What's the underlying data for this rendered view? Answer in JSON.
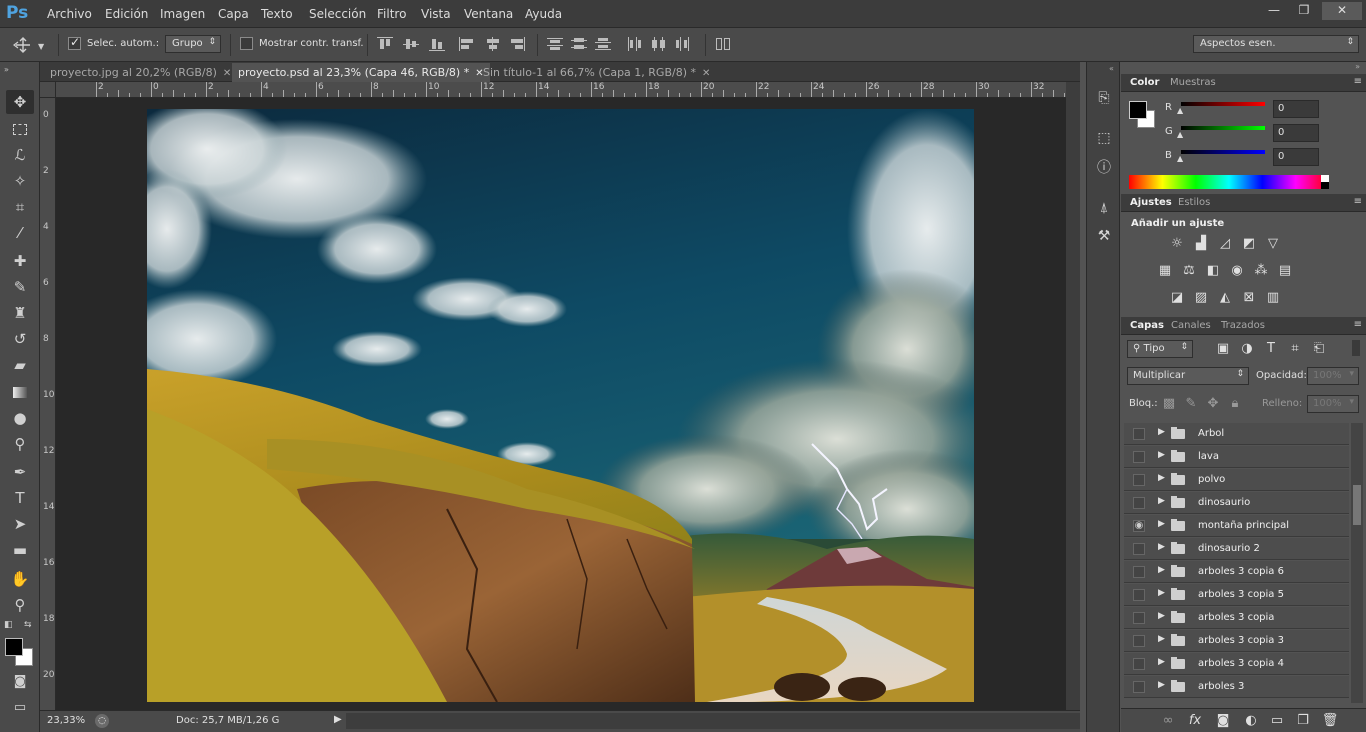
{
  "app": {
    "logo": "Ps",
    "menu": [
      "Archivo",
      "Edición",
      "Imagen",
      "Capa",
      "Texto",
      "Selección",
      "Filtro",
      "Vista",
      "Ventana",
      "Ayuda"
    ],
    "window_controls": [
      "—",
      "❐",
      "✕"
    ]
  },
  "options_bar": {
    "auto_select_label": "Selec. autom.:",
    "auto_select_checked": true,
    "group_value": "Grupo",
    "transform_label": "Mostrar contr. transf.",
    "transform_checked": false,
    "workspace_value": "Aspectos esen."
  },
  "tabs": [
    {
      "label": "proyecto.jpg al 20,2% (RGB/8)",
      "active": false
    },
    {
      "label": "proyecto.psd al 23,3% (Capa 46, RGB/8) *",
      "active": true
    },
    {
      "label": "Sin título-1 al 66,7% (Capa 1, RGB/8) *",
      "active": false
    }
  ],
  "rulers": {
    "horizontal": [
      "2",
      "0",
      "2",
      "4",
      "6",
      "8",
      "10",
      "12",
      "14",
      "16",
      "18",
      "20",
      "22",
      "24",
      "26",
      "28",
      "30",
      "32"
    ],
    "vertical": [
      "0",
      "2",
      "4",
      "6",
      "8",
      "10",
      "12",
      "14",
      "16",
      "18",
      "20"
    ]
  },
  "status": {
    "zoom": "23,33%",
    "doc_info": "Doc: 25,7 MB/1,26 G"
  },
  "color_panel": {
    "tabs": [
      "Color",
      "Muestras"
    ],
    "channels": [
      {
        "label": "R",
        "value": "0",
        "color": "#e02020"
      },
      {
        "label": "G",
        "value": "0",
        "color": "#20c020"
      },
      {
        "label": "B",
        "value": "0",
        "color": "#2030e0"
      }
    ],
    "foreground": "#000000",
    "background": "#ffffff"
  },
  "adjustments_panel": {
    "tabs": [
      "Ajustes",
      "Estilos"
    ],
    "heading": "Añadir un ajuste"
  },
  "layers_panel": {
    "tabs": [
      "Capas",
      "Canales",
      "Trazados"
    ],
    "filter_value": "Tipo",
    "blend_mode": "Multiplicar",
    "opacity_label": "Opacidad:",
    "opacity_value": "100%",
    "lock_label": "Bloq.:",
    "fill_label": "Relleno:",
    "fill_value": "100%",
    "layers": [
      {
        "name": "Arbol",
        "visible": false
      },
      {
        "name": "lava",
        "visible": false
      },
      {
        "name": "polvo",
        "visible": false
      },
      {
        "name": "dinosaurio",
        "visible": false
      },
      {
        "name": "montaña principal",
        "visible": true
      },
      {
        "name": "dinosaurio 2",
        "visible": false
      },
      {
        "name": "arboles 3 copia 6",
        "visible": false
      },
      {
        "name": "arboles 3 copia 5",
        "visible": false
      },
      {
        "name": "arboles 3 copia",
        "visible": false
      },
      {
        "name": "arboles 3 copia 3",
        "visible": false
      },
      {
        "name": "arboles 3 copia 4",
        "visible": false
      },
      {
        "name": "arboles 3",
        "visible": false
      }
    ]
  }
}
